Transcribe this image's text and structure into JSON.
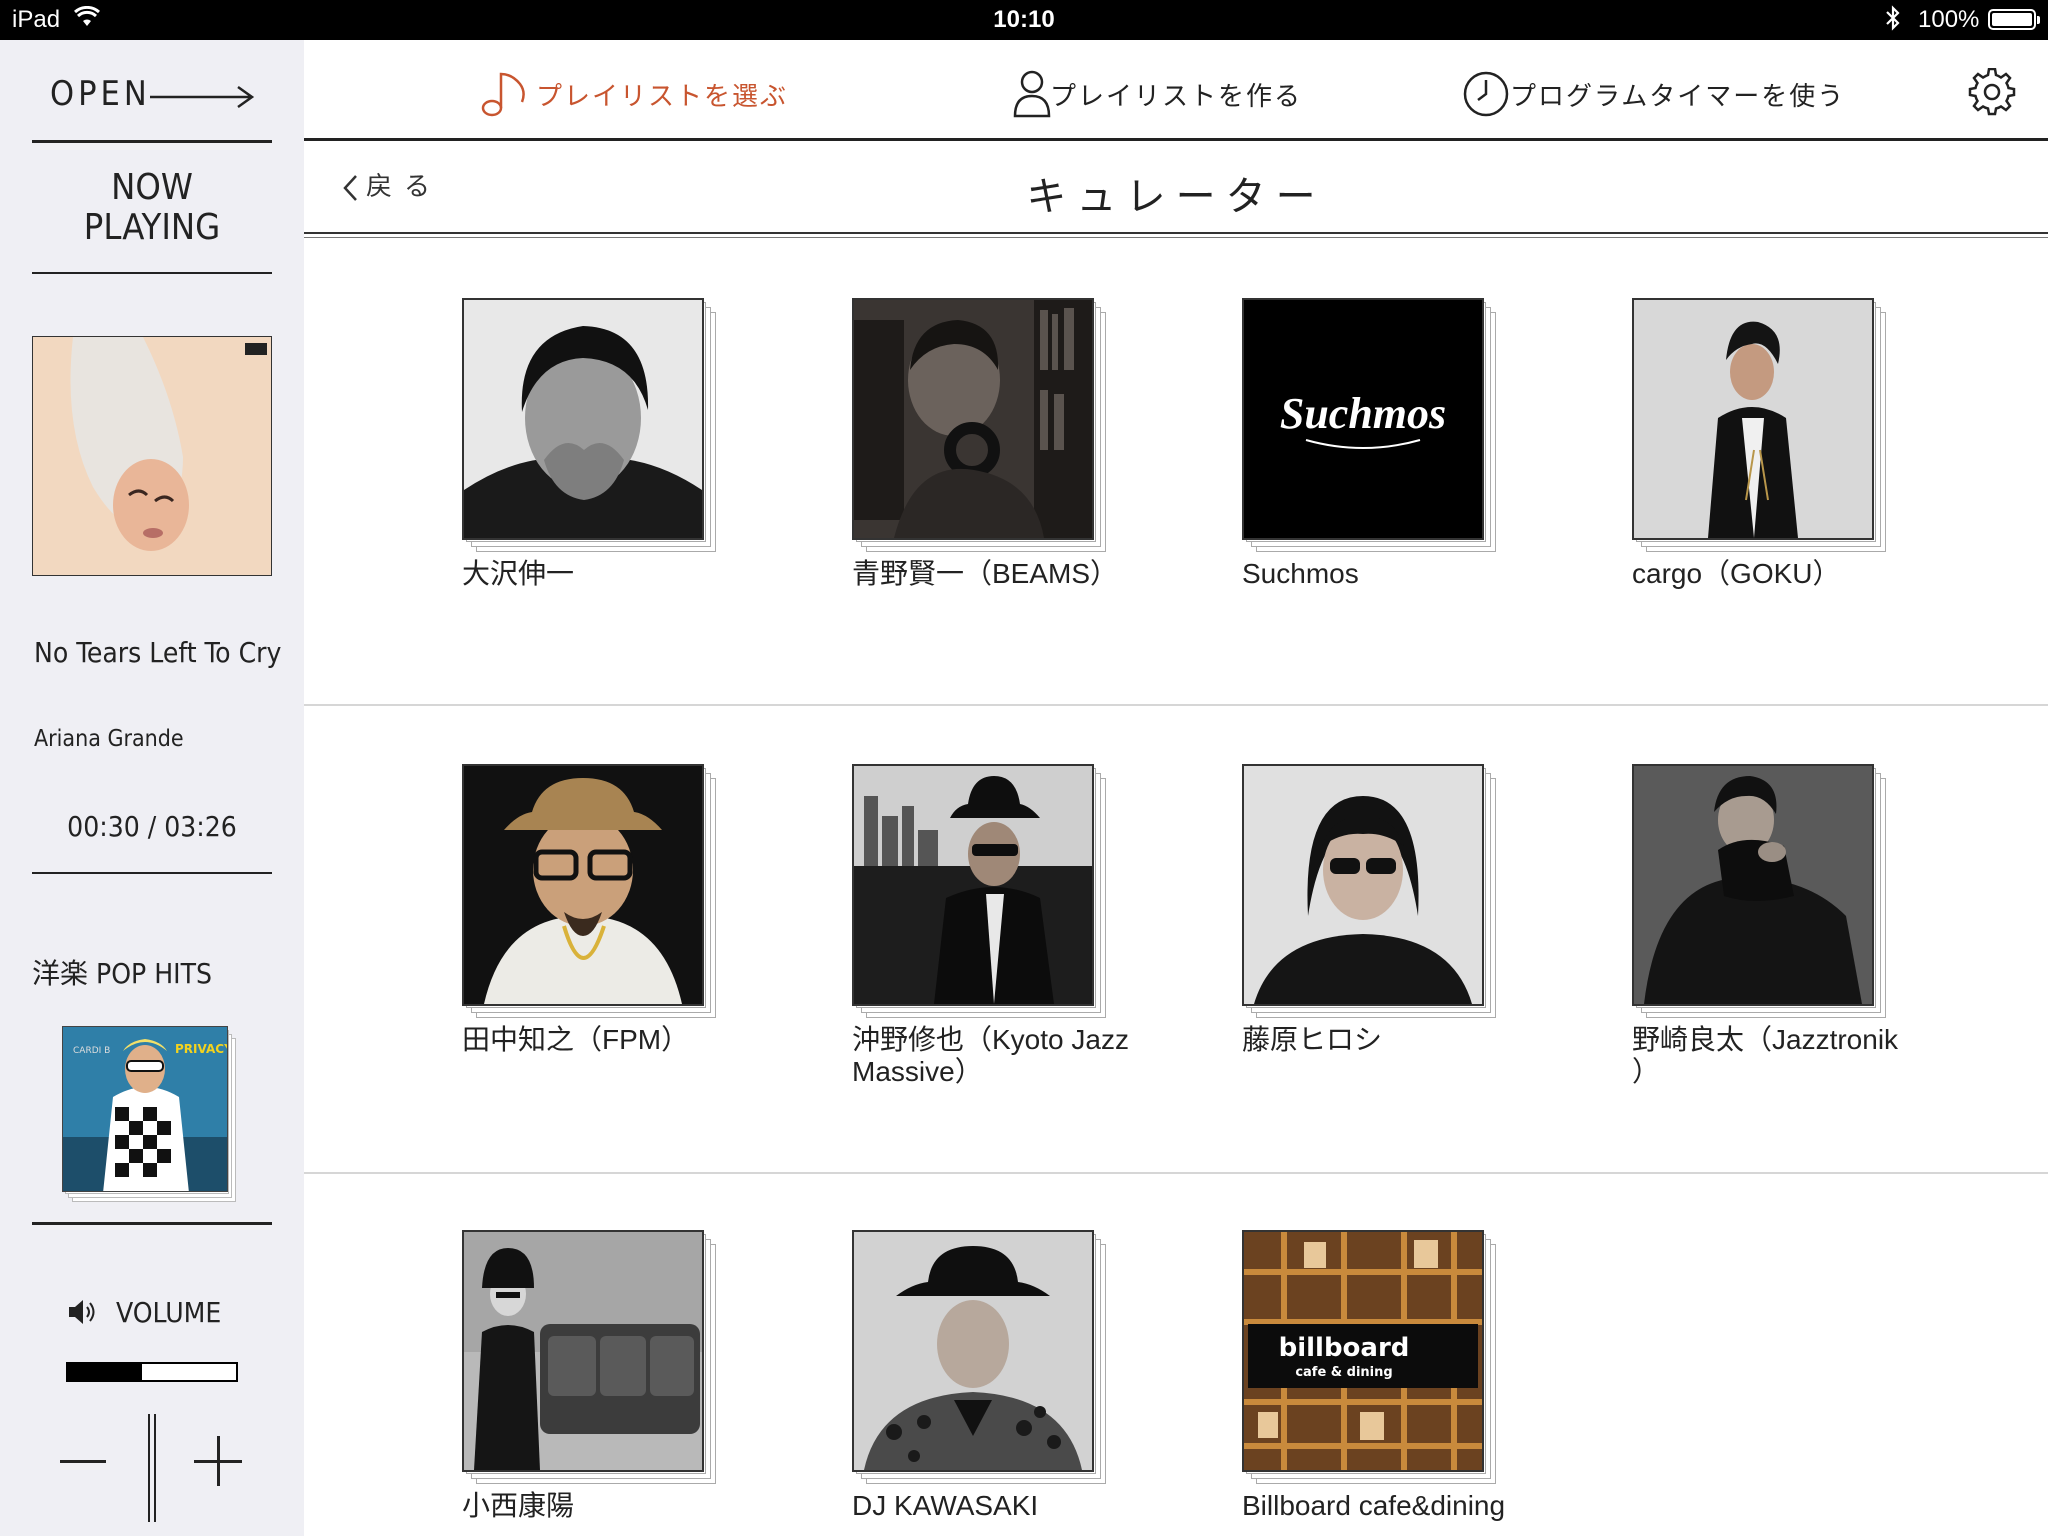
{
  "status_bar": {
    "device": "iPad",
    "time": "10:10",
    "battery": "100%"
  },
  "sidebar": {
    "open_label": "OPEN",
    "now_playing_label": "NOW\nPLAYING",
    "track_title": "No Tears Left To Cry",
    "track_artist": "Ariana Grande",
    "track_time": "00:30 / 03:26",
    "playlist_name": "洋楽 POP HITS",
    "volume_label": "VOLUME",
    "volume_level": 0.44
  },
  "nav": {
    "select_playlist": "プレイリストを選ぶ",
    "make_playlist": "プレイリストを作る",
    "program_timer": "プログラムタイマーを使う"
  },
  "header": {
    "back_label": "戻る",
    "title": "キュレーター"
  },
  "curators": [
    {
      "name": "大沢伸一"
    },
    {
      "name": "青野賢一（BEAMS）"
    },
    {
      "name": "Suchmos",
      "logo": "Suchmos"
    },
    {
      "name": "cargo（GOKU）"
    },
    {
      "name": "田中知之（FPM）"
    },
    {
      "name": "沖野修也（Kyoto Jazz Massive）"
    },
    {
      "name": "藤原ヒロシ"
    },
    {
      "name": "野崎良太（Jazztronik\n）"
    },
    {
      "name": "小西康陽"
    },
    {
      "name": "DJ KAWASAKI"
    },
    {
      "name": "Billboard cafe&dining",
      "logo_line1": "billboard",
      "logo_line2": "cafe & dining"
    }
  ],
  "colors": {
    "accent": "#c8552f",
    "sidebar_bg": "#efeff4",
    "text": "#222222"
  }
}
